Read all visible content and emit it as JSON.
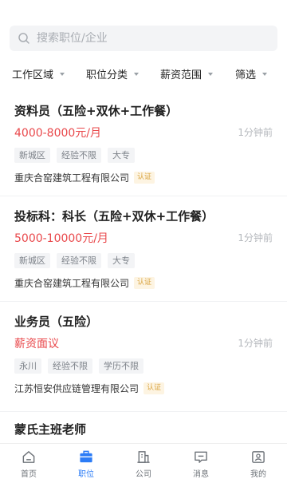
{
  "search": {
    "placeholder": "搜索职位/企业"
  },
  "filters": [
    "工作区域",
    "职位分类",
    "薪资范围",
    "筛选"
  ],
  "jobs": [
    {
      "title": "资料员（五险+双休+工作餐）",
      "salary": "4000-8000元/月",
      "time": "1分钟前",
      "tags": [
        "新城区",
        "经验不限",
        "大专"
      ],
      "company": "重庆合窑建筑工程有限公司",
      "badge": "认证"
    },
    {
      "title": "投标科：科长（五险+双休+工作餐）",
      "salary": "5000-10000元/月",
      "time": "1分钟前",
      "tags": [
        "新城区",
        "经验不限",
        "大专"
      ],
      "company": "重庆合窑建筑工程有限公司",
      "badge": "认证"
    },
    {
      "title": "业务员（五险）",
      "salary": "薪资面议",
      "time": "1分钟前",
      "tags": [
        "永川",
        "经验不限",
        "学历不限"
      ],
      "company": "江苏恒安供应链管理有限公司",
      "badge": "认证"
    }
  ],
  "partial_title": "蒙氏主班老师",
  "tabbar": [
    {
      "label": "首页",
      "icon": "home-icon"
    },
    {
      "label": "职位",
      "icon": "briefcase-icon",
      "active": true
    },
    {
      "label": "公司",
      "icon": "building-icon"
    },
    {
      "label": "消息",
      "icon": "message-icon"
    },
    {
      "label": "我的",
      "icon": "profile-icon"
    }
  ],
  "colors": {
    "accent": "#2c7cf6",
    "salary": "#e9484b",
    "badge": "#d9a441"
  }
}
